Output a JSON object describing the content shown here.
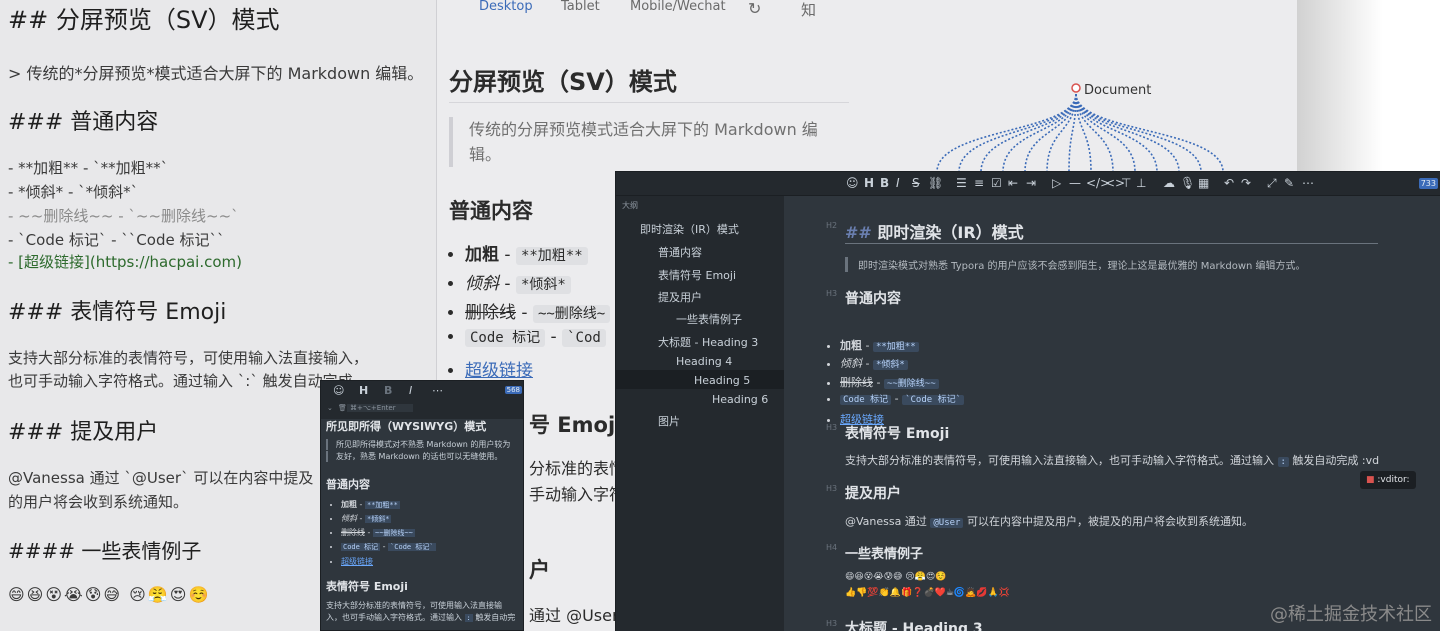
{
  "split_view_source": {
    "h2": "## 分屏预览（SV）模式",
    "quote": "> 传统的*分屏预览*模式适合大屏下的 Markdown 编辑。",
    "h3_normal": "### 普通内容",
    "list": [
      "- **加粗** - `**加粗**`",
      "- *倾斜* - `*倾斜*`",
      "- ~~删除线~~ - `~~删除线~~`",
      "- `Code 标记` - ``Code 标记``",
      "- [超级链接](https://hacpai.com)"
    ],
    "h3_emoji": "### 表情符号 Emoji",
    "emoji_text_1": "支持大部分标准的表情符号，可使用输入法直接输入，",
    "emoji_text_2": "也可手动输入字符格式。通过输入 `:` 触发自动完成",
    "h3_mention": "### 提及用户",
    "mention_text_1": "@Vanessa 通过 `@User` 可以在内容中提及",
    "mention_text_2": "的用户将会收到系统通知。",
    "h4_emoji_examples": "#### 一些表情例子",
    "emoji_row": "😄😆😵😭😰😅 😢😤😍☺️"
  },
  "split_view_preview": {
    "tabs": [
      "Desktop",
      "Tablet",
      "Mobile/Wechat",
      "知"
    ],
    "h2": "分屏预览（SV）模式",
    "quote": "传统的分屏预览模式适合大屏下的 Markdown 编辑。",
    "h3_normal": "普通内容",
    "list": [
      {
        "label": "加粗",
        "code": "**加粗**"
      },
      {
        "label": "倾斜",
        "code": "*倾斜*"
      },
      {
        "label": "删除线",
        "code": "~~删除线~"
      },
      {
        "label": "Code 标记",
        "code": "`Cod"
      }
    ],
    "link": "超级链接",
    "h3_emoji_partial": "号 Emoji",
    "emoji_partial_1": "分标准的表情",
    "emoji_partial_2": "手动输入字符",
    "mention_partial": "通过 @User"
  },
  "mindmap": {
    "root": "Document"
  },
  "ir_panel": {
    "count": "733",
    "outline_title": "大纲",
    "outline": [
      {
        "label": "即时渲染（IR）模式",
        "level": 2
      },
      {
        "label": "普通内容",
        "level": 3
      },
      {
        "label": "表情符号 Emoji",
        "level": 3
      },
      {
        "label": "提及用户",
        "level": 3
      },
      {
        "label": "一些表情例子",
        "level": 4
      },
      {
        "label": "大标题 - Heading 3",
        "level": 3
      },
      {
        "label": "Heading 4",
        "level": 4
      },
      {
        "label": "Heading 5",
        "level": 5
      },
      {
        "label": "Heading 6",
        "level": 6
      },
      {
        "label": "图片",
        "level": 3
      }
    ],
    "h2_marker": "##",
    "h2": "即时渲染（IR）模式",
    "quote": "即时渲染模式对熟悉 Typora 的用户应该不会感到陌生，理论上这是最优雅的 Markdown 编辑方式。",
    "h3_normal": "普通内容",
    "list": [
      {
        "label": "加粗",
        "code": "**加粗**"
      },
      {
        "label": "倾斜",
        "code": "*倾斜*"
      },
      {
        "label": "删除线",
        "code": "~~删除线~~"
      },
      {
        "label": "Code 标记",
        "code": "`Code 标记`"
      }
    ],
    "link": "超级链接",
    "h3_emoji": "表情符号 Emoji",
    "emoji_text": "支持大部分标准的表情符号，可使用输入法直接输入，也可手动输入字符格式。通过输入",
    "emoji_colon": ":",
    "emoji_text_end": "触发自动完成 :vd",
    "autocomplete": ":vditor:",
    "h3_mention": "提及用户",
    "mention_pre": "@Vanessa 通过",
    "mention_code": "@User",
    "mention_post": "可以在内容中提及用户，被提及的用户将会收到系统通知。",
    "h4_emoji": "一些表情例子",
    "emoji_row_1": "😄😆😵😭😰😅 😢😤😍☺️",
    "emoji_row_2": "👍👎💯👏🔔🎁❓💣❤️☕🌀🙇💋🙏💢",
    "h3_big": "大标题 - Heading 3",
    "heading_labels": [
      "H2",
      "H3",
      "H3",
      "H3",
      "H4",
      "H3"
    ]
  },
  "wysiwyg_panel": {
    "count": "568",
    "sub_hint": "⌘+⌥+Enter",
    "h2": "所见即所得（WYSIWYG）模式",
    "quote_1": "所见即所得模式对不熟悉 Markdown 的用户较为",
    "quote_2": "友好，熟悉 Markdown 的话也可以无缝使用。",
    "h3_normal": "普通内容",
    "list": [
      {
        "label": "加粗",
        "code": "**加粗**"
      },
      {
        "label": "倾斜",
        "code": "*倾斜*"
      },
      {
        "label": "删除线",
        "code": "~~删除线~~"
      },
      {
        "label": "Code 标记",
        "code": "`Code 标记`"
      }
    ],
    "link": "超级链接",
    "h3_emoji": "表情符号 Emoji",
    "emoji_text_1": "支持大部分标准的表情符号，可使用输入法直接输",
    "emoji_text_2": "入，也可手动输入字符格式。通过输入",
    "emoji_colon": ":",
    "emoji_text_end": "触发自动完"
  },
  "watermark": "@稀土掘金技术社区",
  "colors": {
    "dark_bg": "#2f363d",
    "toolbar_bg": "#24292e",
    "link": "#3b6bb8",
    "heading_marker": "#5b2b8f"
  }
}
